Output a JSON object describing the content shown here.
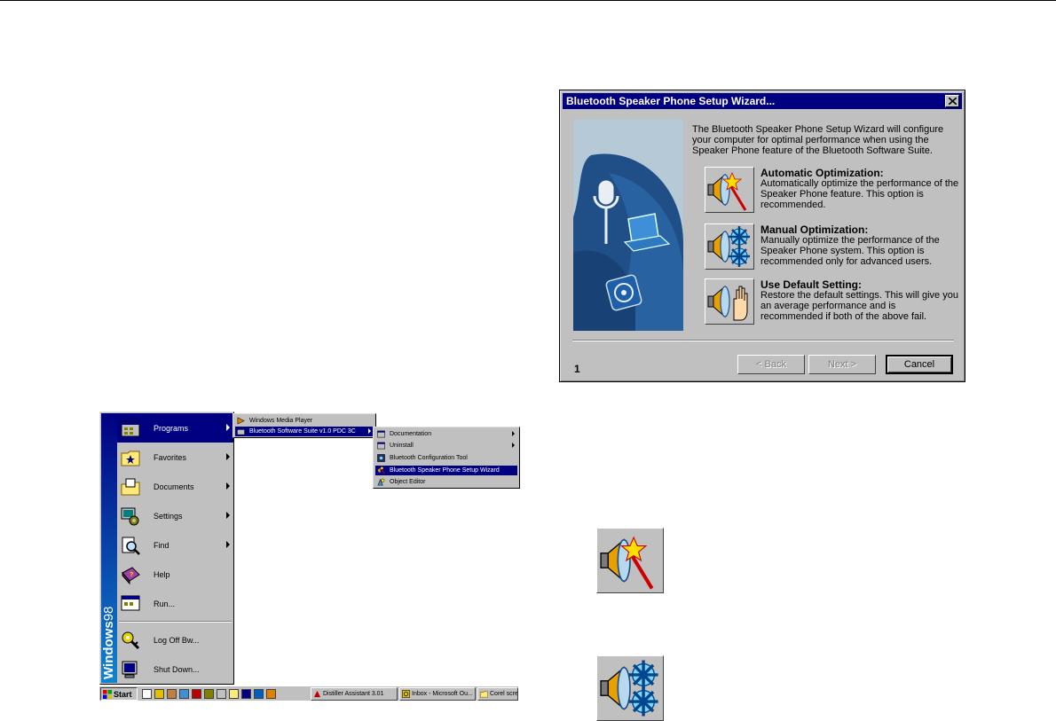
{
  "wizard": {
    "title": "Bluetooth Speaker Phone Setup Wizard...",
    "intro": "The Bluetooth Speaker Phone Setup Wizard will configure your computer for optimal performance when using the Speaker Phone feature of the Bluetooth Software Suite.",
    "options": [
      {
        "title": "Automatic Optimization:",
        "description": "Automatically optimize the performance of the Speaker Phone feature. This option is recommended.",
        "icon": "speaker-magic-wand-icon"
      },
      {
        "title": "Manual Optimization:",
        "description": "Manually optimize the performance of the Speaker Phone system. This option is recommended only for advanced users.",
        "icon": "speaker-gears-icon"
      },
      {
        "title": "Use Default Setting:",
        "description": "Restore the default settings. This will give you an average performance and is recommended if both of the above fail.",
        "icon": "speaker-hand-icon"
      }
    ],
    "page_number": "1",
    "back_label": "< Back",
    "next_label": "Next >",
    "cancel_label": "Cancel",
    "title_bar_color": "#000080"
  },
  "start_menu": {
    "banner": {
      "bold": "Windows",
      "light": "98"
    },
    "items": [
      {
        "label": "Programs",
        "icon": "programs-icon",
        "submenu": true,
        "active": true
      },
      {
        "label": "Favorites",
        "icon": "favorites-folder-icon",
        "submenu": true
      },
      {
        "label": "Documents",
        "icon": "documents-folder-icon",
        "submenu": true
      },
      {
        "label": "Settings",
        "icon": "settings-icon",
        "submenu": true
      },
      {
        "label": "Find",
        "icon": "find-icon",
        "submenu": true
      },
      {
        "label": "Help",
        "icon": "help-book-icon",
        "submenu": false
      },
      {
        "label": "Run...",
        "icon": "run-icon",
        "submenu": false
      },
      {
        "label": "Log Off Bw...",
        "icon": "log-off-key-icon",
        "submenu": false
      },
      {
        "label": "Shut Down...",
        "icon": "shut-down-monitor-icon",
        "submenu": false
      }
    ]
  },
  "programs_menu": {
    "items": [
      {
        "label": "Windows Media Player",
        "icon": "media-player-icon",
        "submenu": false
      },
      {
        "label": "Bluetooth Software Suite v1.0 PDC 3C",
        "icon": "program-group-icon",
        "submenu": true,
        "active": true
      }
    ]
  },
  "bluetooth_menu": {
    "items": [
      {
        "label": "Documentation",
        "icon": "program-group-icon",
        "submenu": true
      },
      {
        "label": "Uninstall",
        "icon": "program-group-icon",
        "submenu": true
      },
      {
        "label": "Bluetooth Configuration Tool",
        "icon": "config-tool-icon",
        "submenu": false
      },
      {
        "label": "Bluetooth Speaker Phone Setup Wizard",
        "icon": "speaker-wizard-icon",
        "submenu": false,
        "active": true
      },
      {
        "label": "Object Editor",
        "icon": "object-editor-icon",
        "submenu": false
      }
    ]
  },
  "taskbar": {
    "start_label": "Start",
    "tasks": [
      {
        "label": "Distiller Assistant 3.01",
        "icon": "distiller-icon"
      },
      {
        "label": "Inbox - Microsoft Ou...",
        "icon": "outlook-icon"
      },
      {
        "label": "Corel scre",
        "icon": "folder-icon"
      }
    ]
  }
}
